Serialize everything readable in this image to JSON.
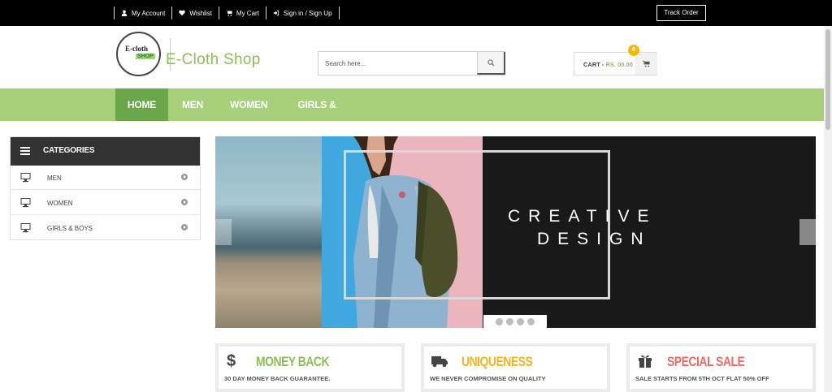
{
  "topbar": {
    "links": [
      {
        "label": "My Account",
        "icon": "user-icon"
      },
      {
        "label": "Wishlist",
        "icon": "heart-icon"
      },
      {
        "label": "My Cart",
        "icon": "cart-icon"
      },
      {
        "label": "Sign in / Sign Up",
        "icon": "sign-in-icon"
      }
    ],
    "track_order": "Track Order"
  },
  "header": {
    "logo_line1": "E-cloth",
    "logo_line2": "SHOP",
    "brand": "E-Cloth Shop",
    "search_placeholder": "Search here...",
    "cart_label": "CART - ",
    "cart_price": "RS. 00.00",
    "cart_count": "0"
  },
  "nav": {
    "items": [
      "HOME",
      "MEN",
      "WOMEN",
      "GIRLS & BOYS"
    ],
    "active": "HOME"
  },
  "categories": {
    "title": "CATEGORIES",
    "items": [
      "MEN",
      "WOMEN",
      "GIRLS & BOYS"
    ]
  },
  "slider": {
    "line1": "CREATIVE",
    "line2": "DESIGN",
    "dot_count": 4
  },
  "features": [
    {
      "title": "MONEY BACK",
      "subtitle": "30 DAY MONEY BACK GUARANTEE.",
      "color": "#8dbd56",
      "icon": "dollar-icon"
    },
    {
      "title": "UNIQUENESS",
      "subtitle": "WE NEVER COMPROMISE ON QUALITY",
      "color": "#f5b31e",
      "icon": "truck-icon"
    },
    {
      "title": "SPECIAL SALE",
      "subtitle": "SALE STARTS FROM 5TH OCT FLAT 50% OFF",
      "color": "#ef6a63",
      "icon": "gift-icon"
    }
  ],
  "colors": {
    "nav_bg": "#a7d07a",
    "nav_active": "#6aa64a",
    "brand": "#8dbd56",
    "badge": "#f5b90a"
  }
}
